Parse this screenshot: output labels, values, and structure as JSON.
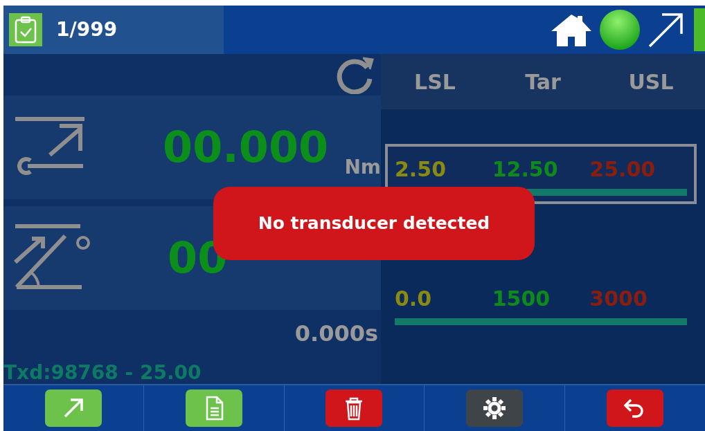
{
  "header": {
    "counter": "1/999",
    "status_ok": true
  },
  "torque": {
    "value": "00.000",
    "unit": "Nm"
  },
  "angle": {
    "value": "00"
  },
  "time": "0.000s",
  "transducer": "Txd:98768 - 25.00",
  "limits": {
    "columns": [
      "LSL",
      "Tar",
      "USL"
    ],
    "rows": [
      {
        "values": [
          "2.50",
          "12.50",
          "25.00"
        ],
        "selected": true
      },
      {
        "values": [
          "0.0",
          "1500",
          "3000"
        ],
        "selected": false
      }
    ]
  },
  "alert": "No transducer detected",
  "toolbar": [
    {
      "kind": "arrow",
      "color": "#6cc24a"
    },
    {
      "kind": "document",
      "color": "#6cc24a"
    },
    {
      "kind": "trash",
      "color": "#d0161a"
    },
    {
      "kind": "gear",
      "color": "#3f4448"
    },
    {
      "kind": "back",
      "color": "#d0161a"
    }
  ]
}
